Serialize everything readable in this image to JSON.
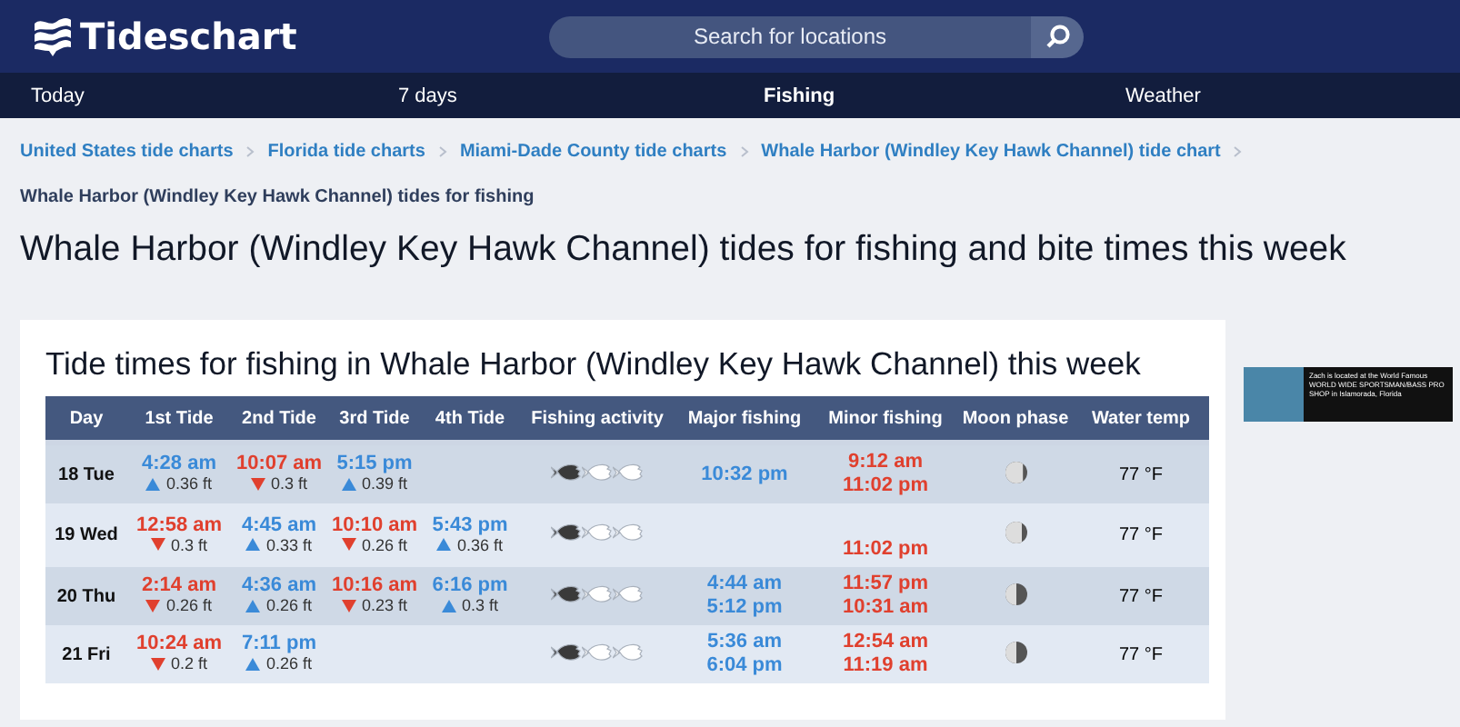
{
  "header": {
    "logo": "Tideschart",
    "search": {
      "placeholder": "Search for locations"
    }
  },
  "nav": [
    {
      "label": "Today",
      "selected": false
    },
    {
      "label": "7 days",
      "selected": false
    },
    {
      "label": "Fishing",
      "selected": true
    },
    {
      "label": "Weather",
      "selected": false
    }
  ],
  "breadcrumbs": [
    "United States tide charts",
    "Florida tide charts",
    "Miami-Dade County tide charts",
    "Whale Harbor (Windley Key Hawk Channel) tide chart"
  ],
  "current_page": "Whale Harbor (Windley Key Hawk Channel) tides for fishing",
  "title": "Whale Harbor (Windley Key Hawk Channel) tides for fishing and bite times this week",
  "card": {
    "title": "Tide times for fishing in Whale Harbor (Windley Key Hawk Channel) this week",
    "table": {
      "columns": [
        "Day",
        "1st Tide",
        "2nd Tide",
        "3rd Tide",
        "4th Tide",
        "Fishing activity",
        "Major fishing",
        "Minor fishing",
        "Moon phase",
        "Water temp"
      ],
      "rows": [
        {
          "day": "18 Tue",
          "tides": [
            {
              "kind": "high",
              "time": "4:28 am",
              "height": "0.36 ft"
            },
            {
              "kind": "low",
              "time": "10:07 am",
              "height": "0.3 ft"
            },
            {
              "kind": "high",
              "time": "5:15 pm",
              "height": "0.39 ft"
            }
          ],
          "activity": {
            "stars": 1
          },
          "major": [
            "10:32 pm"
          ],
          "minor": [
            "9:12 am",
            "11:02 pm"
          ],
          "moon": {
            "level": 0.8
          },
          "water_temp": "77 °F"
        },
        {
          "day": "19 Wed",
          "tides": [
            {
              "kind": "low",
              "time": "12:58 am",
              "height": "0.3 ft"
            },
            {
              "kind": "high",
              "time": "4:45 am",
              "height": "0.33 ft"
            },
            {
              "kind": "low",
              "time": "10:10 am",
              "height": "0.26 ft"
            },
            {
              "kind": "high",
              "time": "5:43 pm",
              "height": "0.36 ft"
            }
          ],
          "activity": {
            "stars": 1
          },
          "major": [],
          "minor": [
            "11:02 pm"
          ],
          "moon": {
            "level": 0.75
          },
          "water_temp": "77 °F"
        },
        {
          "day": "20 Thu",
          "tides": [
            {
              "kind": "low",
              "time": "2:14 am",
              "height": "0.26 ft"
            },
            {
              "kind": "high",
              "time": "4:36 am",
              "height": "0.26 ft"
            },
            {
              "kind": "low",
              "time": "10:16 am",
              "height": "0.23 ft"
            },
            {
              "kind": "high",
              "time": "6:16 pm",
              "height": "0.3 ft"
            }
          ],
          "activity": {
            "stars": 1
          },
          "major": [
            "4:44 am",
            "5:12 pm"
          ],
          "minor": [
            "11:57 pm",
            "10:31 am"
          ],
          "moon": {
            "level": 0.5
          },
          "water_temp": "77 °F"
        },
        {
          "day": "21 Fri",
          "tides": [
            {
              "kind": "low",
              "time": "10:24 am",
              "height": "0.2 ft"
            },
            {
              "kind": "high",
              "time": "7:11 pm",
              "height": "0.26 ft"
            }
          ],
          "activity": {
            "stars": 1
          },
          "major": [
            "5:36 am",
            "6:04 pm"
          ],
          "minor": [
            "12:54 am",
            "11:19 am"
          ],
          "moon": {
            "level": 0.5
          },
          "water_temp": "77 °F"
        }
      ]
    }
  },
  "ad": {
    "text": "Zach is located at the World Famous WORLD WIDE SPORTSMAN/BASS PRO SHOP in Islamorada, Florida"
  }
}
